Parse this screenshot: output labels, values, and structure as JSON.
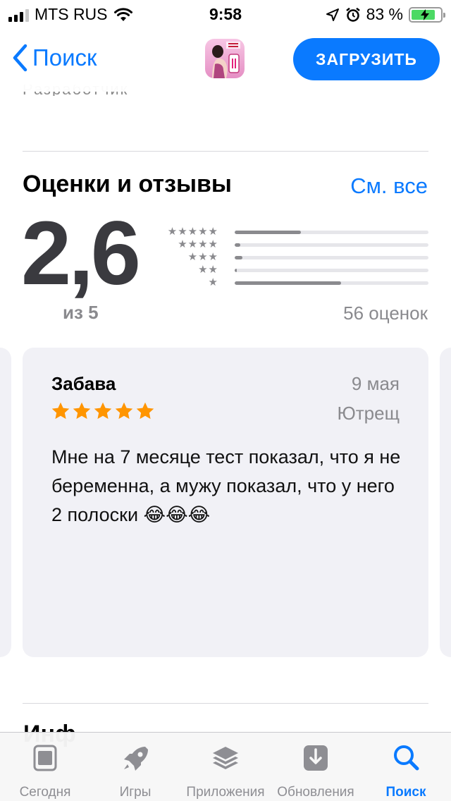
{
  "status_bar": {
    "carrier": "MTS RUS",
    "time": "9:58",
    "battery_percent": "83 %",
    "battery_level": 0.83,
    "icons": [
      "signal-icon",
      "wifi-icon",
      "location-arrow-icon",
      "alarm-icon",
      "battery-icon",
      "charging-bolt-icon"
    ]
  },
  "nav": {
    "back_label": "Поиск",
    "get_label": "ЗАГРУЗИТЬ",
    "faded_text": "Разработчик"
  },
  "ratings": {
    "title": "Оценки и отзывы",
    "see_all": "См. все",
    "score": "2,6",
    "out_of": "из 5",
    "count_label": "56 оценок",
    "distribution": [
      {
        "stars": "★★★★★",
        "fraction": 0.34
      },
      {
        "stars": "★★★★",
        "fraction": 0.03
      },
      {
        "stars": "★★★",
        "fraction": 0.04
      },
      {
        "stars": "★★",
        "fraction": 0.01
      },
      {
        "stars": "★",
        "fraction": 0.55
      }
    ]
  },
  "review": {
    "author": "Забава",
    "date": "9 мая",
    "nickname": "Ютрещ",
    "rating": 5,
    "body": "Мне на 7 месяце тест показал, что я не беременна, а мужу показал, что у него 2 полоски 😂😂😂"
  },
  "next_section_title": "Инф",
  "tabbar": {
    "items": [
      {
        "label": "Сегодня",
        "icon": "today-icon",
        "active": false
      },
      {
        "label": "Игры",
        "icon": "rocket-icon",
        "active": false
      },
      {
        "label": "Приложения",
        "icon": "apps-stack-icon",
        "active": false
      },
      {
        "label": "Обновления",
        "icon": "updates-download-icon",
        "active": false
      },
      {
        "label": "Поиск",
        "icon": "search-icon",
        "active": true
      }
    ]
  },
  "colors": {
    "accent": "#0a7aff",
    "star_orange": "#ff9500",
    "bar_fill": "#8a8a8e",
    "card_bg": "#f1f1f6",
    "battery_green": "#4cd964"
  }
}
